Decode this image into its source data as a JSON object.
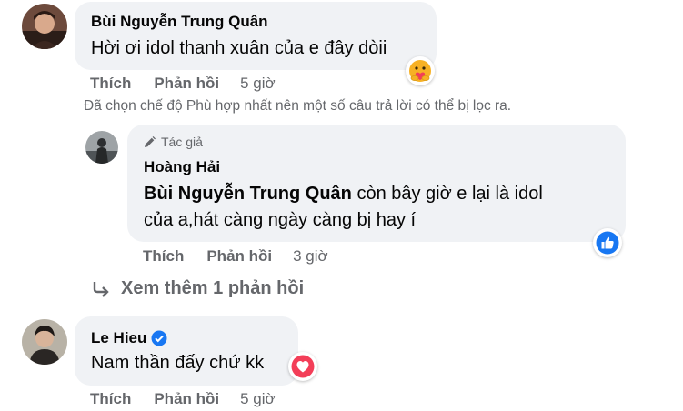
{
  "comment1": {
    "author": "Bùi Nguyễn Trung Quân",
    "text": "Hời ơi idol thanh xuân của e đây dòii",
    "reaction_icon": "care-reaction-icon",
    "like_label": "Thích",
    "reply_label": "Phản hồi",
    "time": "5 giờ"
  },
  "filter_notice": "Đã chọn chế độ Phù hợp nhất nên một số câu trả lời có thể bị lọc ra.",
  "reply1": {
    "author_badge": "Tác giả",
    "author": "Hoàng Hải",
    "mention": "Bùi Nguyễn Trung Quân",
    "text_after_mention": " còn bây giờ e lại là idol",
    "text_line2": "của a,hát càng ngày càng bị hay í",
    "reaction_icon": "like-reaction-icon",
    "like_label": "Thích",
    "reply_label": "Phản hồi",
    "time": "3 giờ"
  },
  "view_more": "Xem thêm 1 phản hồi",
  "comment2": {
    "author": "Le Hieu",
    "verified_icon": "verified-badge-icon",
    "text": "Nam thần đấy chứ kk",
    "reaction_icon": "love-reaction-icon",
    "like_label": "Thích",
    "reply_label": "Phản hồi",
    "time": "5 giờ"
  },
  "colors": {
    "bubble": "#f0f2f5",
    "secondary_text": "#65676b",
    "like_blue": "#1877f2",
    "love_red": "#f33e58",
    "care_yellow": "#f7b125"
  }
}
